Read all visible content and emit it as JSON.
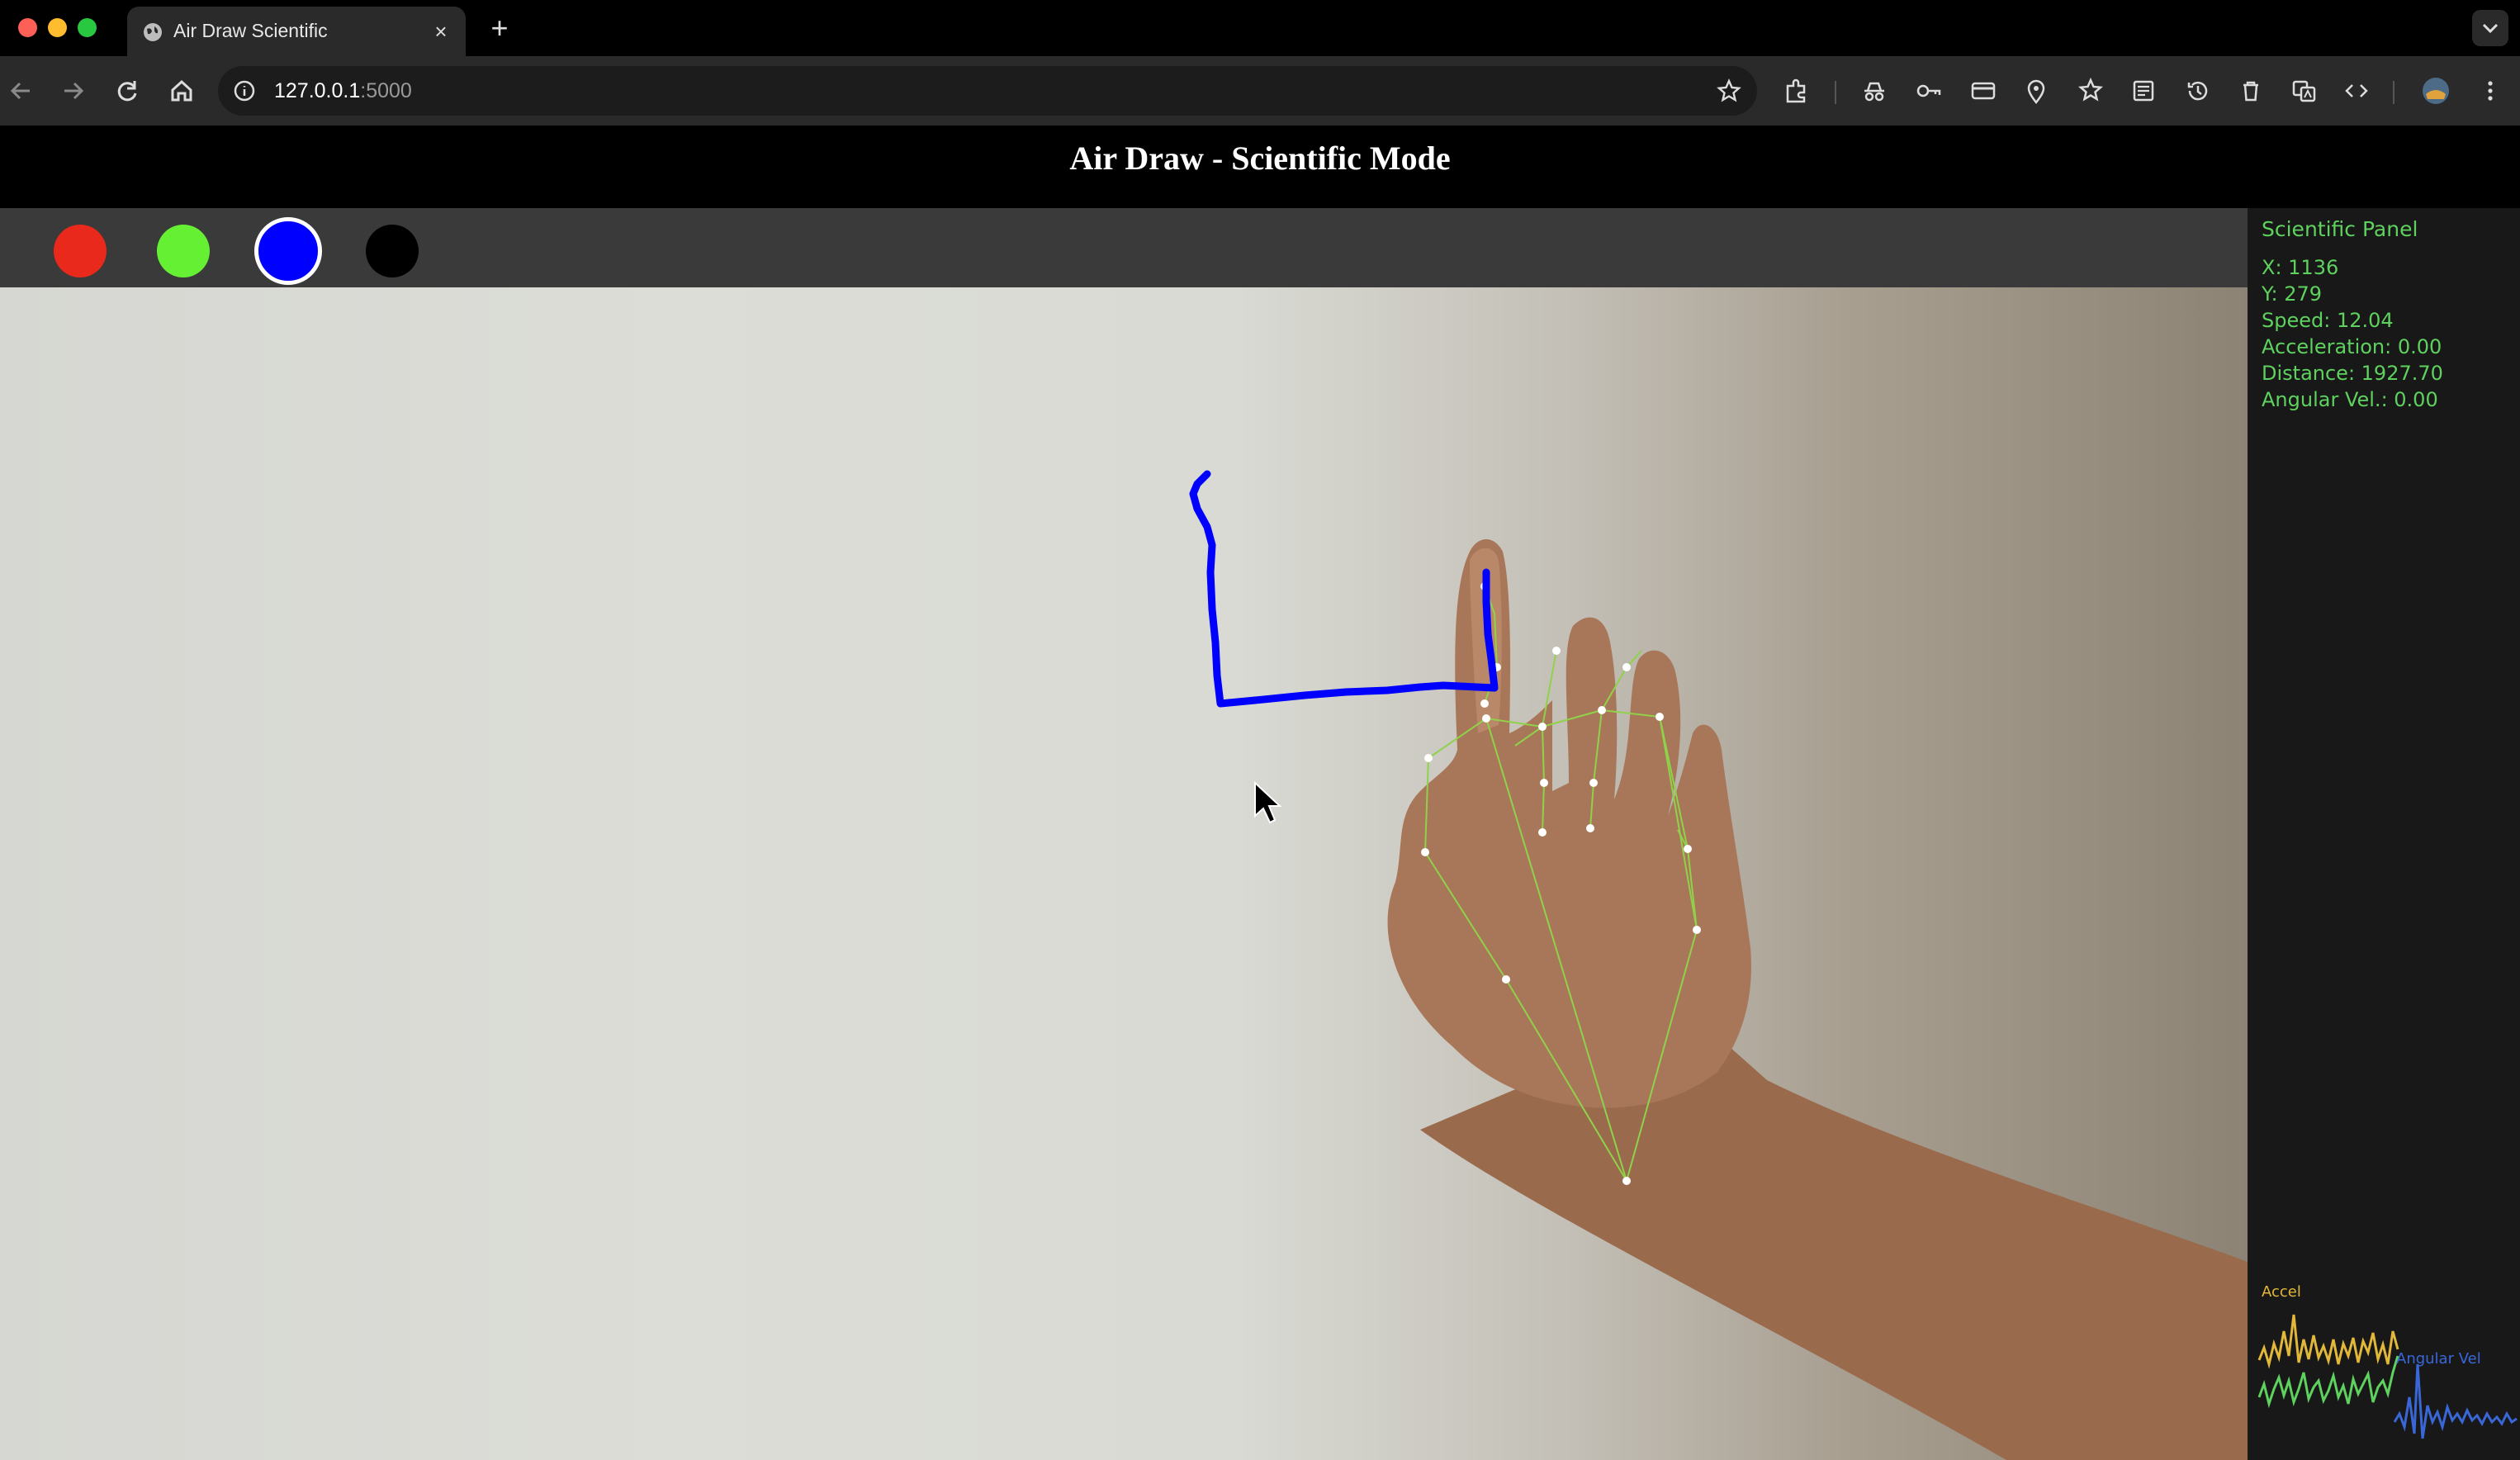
{
  "browser": {
    "tab_title": "Air Draw Scientific",
    "tab_close": "×",
    "new_tab": "+",
    "url_host": "127.0.0.1",
    "url_port": ":5000"
  },
  "page": {
    "title": "Air Draw - Scientific Mode"
  },
  "palette": {
    "colors": [
      "#e8291c",
      "#66f034",
      "#0000ff",
      "#000000"
    ],
    "selected_index": 2,
    "stroke_color": "#0000ff"
  },
  "panel": {
    "title": "Scientific Panel",
    "x": "X: 1136",
    "y": "Y: 279",
    "speed": "Speed: 12.04",
    "acceleration": "Acceleration: 0.00",
    "distance": "Distance: 1927.70",
    "angular_velocity": "Angular Vel.: 0.00",
    "graph_accel_label": "Accel",
    "graph_angular_label": "Angular Vel",
    "colors": {
      "text": "#5ed15e",
      "accel": "#e2b83a",
      "angular": "#3a67d8"
    }
  }
}
